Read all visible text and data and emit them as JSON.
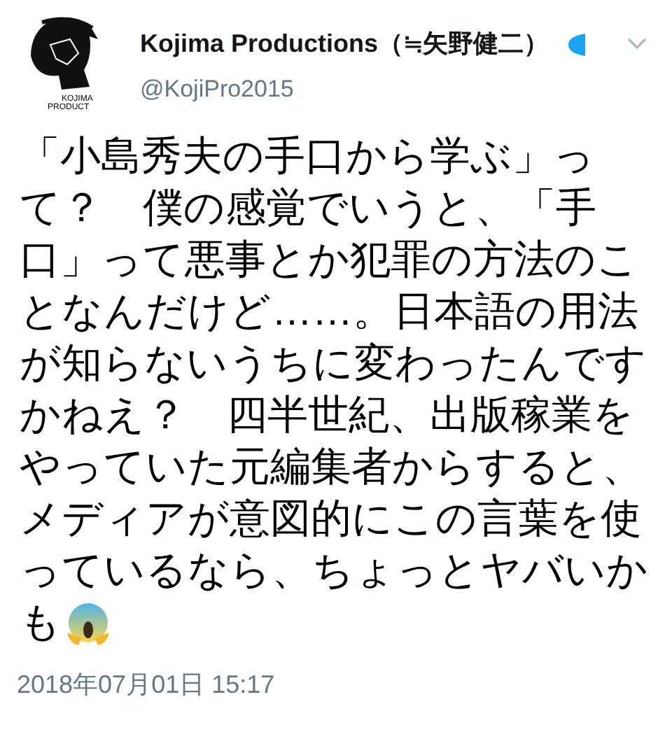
{
  "tweet": {
    "author": {
      "name": "Kojima Productions（≒矢野健二）",
      "handle": "@KojiPro2015",
      "verified": true,
      "logo_text": [
        "KOJIMA",
        "PRODUCT"
      ]
    },
    "text_lines": [
      "「小島秀夫の手口から学ぶ」っ",
      "て？　僕の感覚でいうと、「手",
      "口」って悪事とか犯罪の方法のこ",
      "となんだけど……。日本語の用法",
      "が知らないうちに変わったんです",
      "かねえ？　四半世紀、出版稼業を",
      "やっていた元編集者からすると、",
      "メディアが意図的にこの言葉を使",
      "っているなら、ちょっとヤバいか",
      "も"
    ],
    "timestamp": "2018年07月01日 15:17"
  }
}
